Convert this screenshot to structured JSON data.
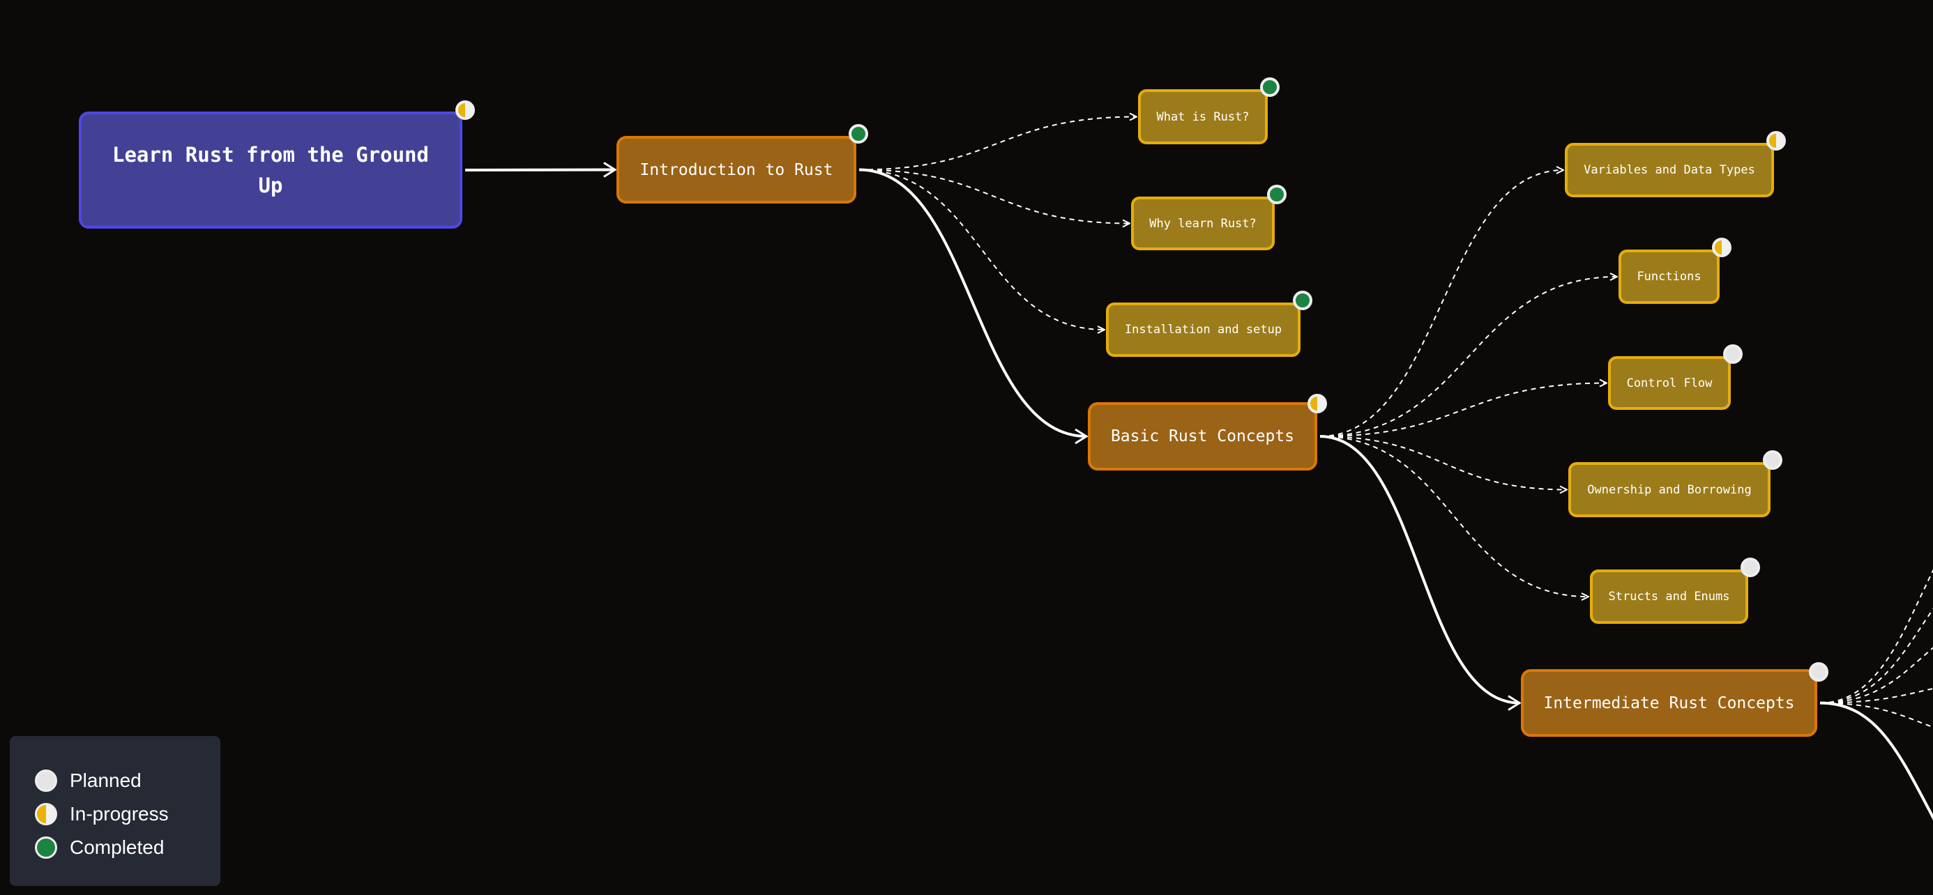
{
  "colors": {
    "background": "#0b0a09",
    "root_fill": "#434196",
    "root_border": "#4f46e5",
    "topic_fill": "#9b6316",
    "topic_border": "#d97706",
    "subtopic_fill": "#9c7c1a",
    "subtopic_border": "#e5ad0b",
    "status_completed": "#1c8443",
    "status_in_progress": "#eab308",
    "status_planned": "#e5e5e5",
    "edge": "#ffffff"
  },
  "root": {
    "label": "Learn Rust from the Ground Up",
    "status": "in-progress"
  },
  "topics": [
    {
      "id": "intro",
      "label": "Introduction to Rust",
      "status": "completed",
      "subtopics": [
        {
          "label": "What is Rust?",
          "status": "completed"
        },
        {
          "label": "Why learn Rust?",
          "status": "completed"
        },
        {
          "label": "Installation and setup",
          "status": "completed"
        }
      ]
    },
    {
      "id": "basic",
      "label": "Basic Rust Concepts",
      "status": "in-progress",
      "subtopics": [
        {
          "label": "Variables and Data Types",
          "status": "in-progress"
        },
        {
          "label": "Functions",
          "status": "in-progress"
        },
        {
          "label": "Control Flow",
          "status": "planned"
        },
        {
          "label": "Ownership and Borrowing",
          "status": "planned"
        },
        {
          "label": "Structs and Enums",
          "status": "planned"
        }
      ]
    },
    {
      "id": "intermediate",
      "label": "Intermediate Rust Concepts",
      "status": "planned",
      "subtopics": []
    }
  ],
  "legend": {
    "items": [
      {
        "label": "Planned",
        "status": "planned"
      },
      {
        "label": "In-progress",
        "status": "in-progress"
      },
      {
        "label": "Completed",
        "status": "completed"
      }
    ]
  }
}
